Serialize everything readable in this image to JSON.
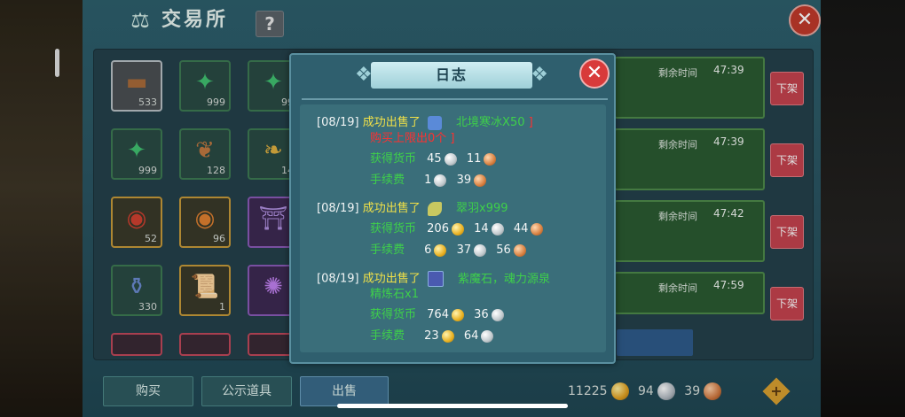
{
  "panel": {
    "title": "交易所",
    "help_label": "?",
    "close_label": "✕"
  },
  "grid_items": [
    {
      "count": "533"
    },
    {
      "count": "999"
    },
    {
      "count": "99"
    },
    {
      "count": "999"
    },
    {
      "count": "128"
    },
    {
      "count": "14"
    },
    {
      "count": "52"
    },
    {
      "count": "96"
    },
    {
      "count": ""
    },
    {
      "count": "330"
    },
    {
      "count": "1"
    },
    {
      "count": ""
    }
  ],
  "listings": [
    {
      "label": "剩余时间",
      "time": "47:39",
      "action": "下架"
    },
    {
      "label": "剩余时间",
      "time": "47:39",
      "action": "下架"
    },
    {
      "label": "剩余时间",
      "time": "47:42",
      "action": "下架"
    },
    {
      "label": "剩余时间",
      "time": "47:59",
      "action": "下架"
    }
  ],
  "tabs": {
    "buy": "购买",
    "public_items": "公示道具",
    "sell": "出售"
  },
  "currency": {
    "gold": "11225",
    "silver": "94",
    "copper": "39",
    "add_label": "+"
  },
  "modal": {
    "title": "日志",
    "close_label": "✕",
    "entries": [
      {
        "date": "[08/19]",
        "action": "成功出售了",
        "item_name": "北境寒冰X50",
        "bracket_end": "]",
        "note": "购买上限出0个",
        "note_end": "]",
        "earned_label": "获得货币",
        "earned": [
          "45",
          "11"
        ],
        "fee_label": "手续费",
        "fee": [
          "1",
          "39"
        ]
      },
      {
        "date": "[08/19]",
        "action": "成功出售了",
        "item_name": "翠羽x999",
        "earned_label": "获得货币",
        "earned": [
          "206",
          "14",
          "44"
        ],
        "fee_label": "手续费",
        "fee": [
          "6",
          "37",
          "56"
        ]
      },
      {
        "date": "[08/19]",
        "action": "成功出售了",
        "item_name": "紫魔石，魂力源泉",
        "note": "精炼石x1",
        "earned_label": "获得货币",
        "earned": [
          "764",
          "36"
        ],
        "fee_label": "手续费",
        "fee": [
          "23",
          "64"
        ]
      }
    ]
  },
  "colors": {
    "panel_bg": "#2b5663",
    "modal_bg": "#2f5f6e",
    "log_bg": "#3a6e7a",
    "highlight_yellow": "#f0e048",
    "item_green": "#3ed04a",
    "warning_red": "#ff3030",
    "close_red": "#d83a3a"
  }
}
